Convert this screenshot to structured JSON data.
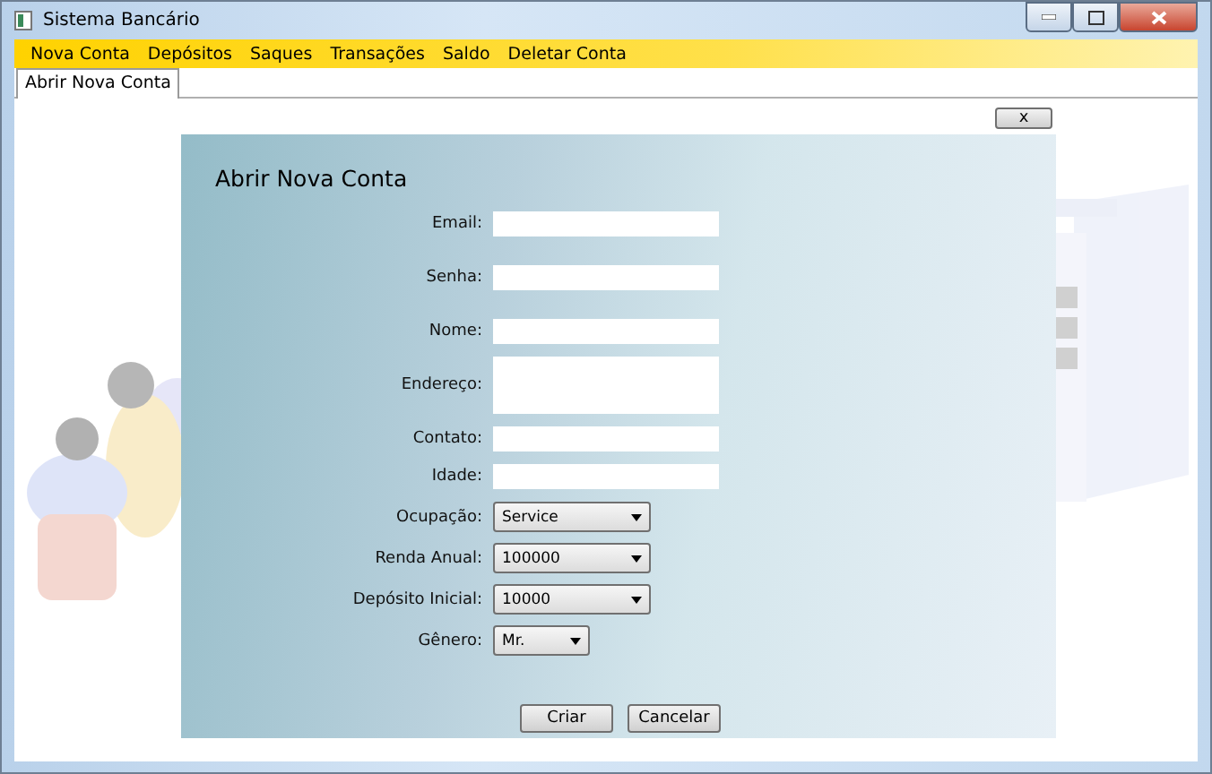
{
  "window": {
    "title": "Sistema Bancário"
  },
  "menu": [
    {
      "label": "Nova Conta"
    },
    {
      "label": "Depósitos"
    },
    {
      "label": "Saques"
    },
    {
      "label": "Transações"
    },
    {
      "label": "Saldo"
    },
    {
      "label": "Deletar Conta"
    }
  ],
  "tabs": [
    {
      "label": "Abrir Nova Conta",
      "selected": true
    }
  ],
  "close_button": "x",
  "form": {
    "title": "Abrir Nova Conta",
    "fields": [
      {
        "kind": "text",
        "label": "Email:"
      },
      {
        "kind": "text",
        "label": "Senha:"
      },
      {
        "kind": "text",
        "label": "Nome:"
      },
      {
        "kind": "textarea",
        "label": "Endereço:"
      },
      {
        "kind": "text",
        "label": "Contato:"
      },
      {
        "kind": "text",
        "label": "Idade:"
      },
      {
        "kind": "select",
        "label": "Ocupação:",
        "value": "Service"
      },
      {
        "kind": "select",
        "label": "Renda Anual:",
        "value": "100000"
      },
      {
        "kind": "select",
        "label": "Depósito Inicial:",
        "value": "10000"
      },
      {
        "kind": "select_small",
        "label": "Gênero:",
        "value": "Mr."
      }
    ],
    "buttons": [
      "Criar",
      "Cancelar"
    ]
  }
}
